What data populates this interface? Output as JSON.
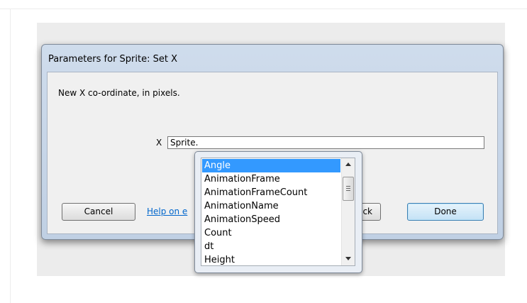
{
  "dialog": {
    "title": "Parameters for Sprite: Set X",
    "description": "New X co-ordinate, in pixels.",
    "param_label": "X",
    "param_value": "Sprite.",
    "cancel_label": "Cancel",
    "help_label": "Help on e",
    "back_label": "ck",
    "done_label": "Done"
  },
  "autocomplete": {
    "items": [
      "Angle",
      "AnimationFrame",
      "AnimationFrameCount",
      "AnimationName",
      "AnimationSpeed",
      "Count",
      "dt",
      "Height"
    ],
    "selected_index": 0
  },
  "colors": {
    "selection": "#3399ff",
    "link": "#0066cc",
    "dialog_frame": "#c0d0e4"
  }
}
